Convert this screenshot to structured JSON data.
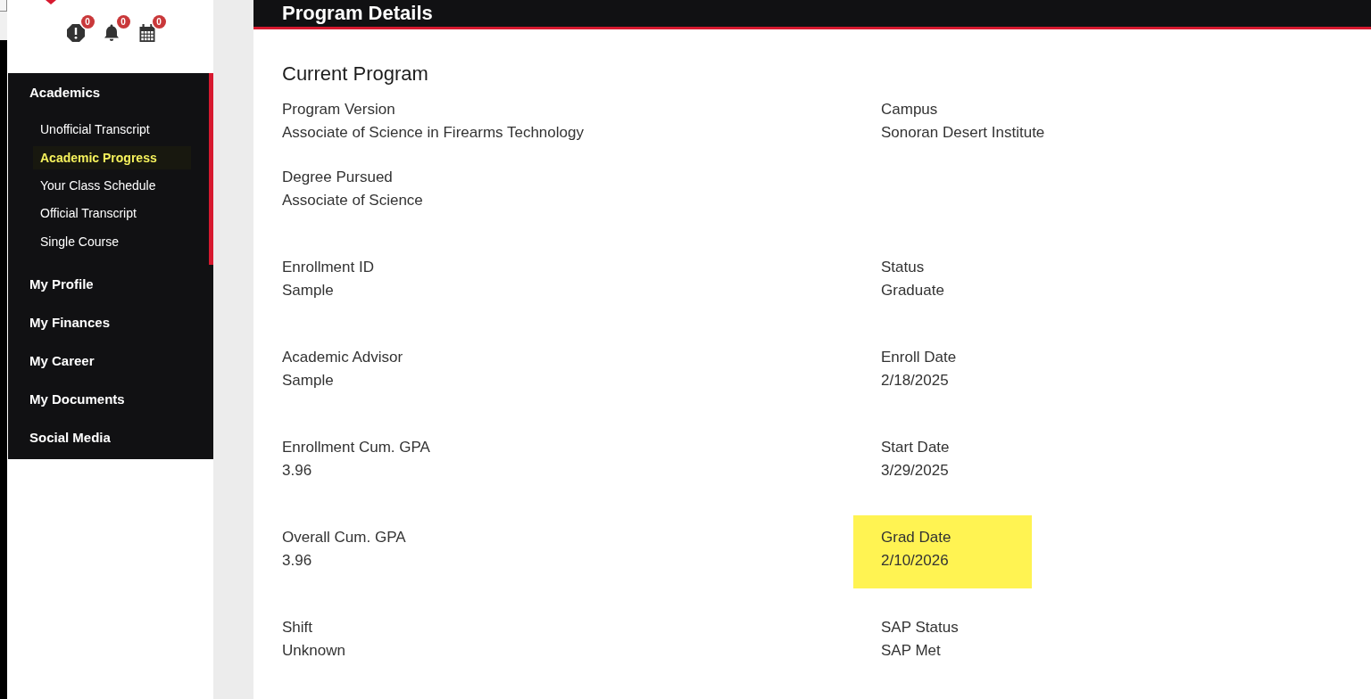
{
  "sidebar": {
    "notifications": [
      {
        "kind": "alert",
        "count": "0"
      },
      {
        "kind": "bell",
        "count": "0"
      },
      {
        "kind": "calendar",
        "count": "0"
      }
    ],
    "menu": [
      {
        "label": "Academics",
        "expanded": true,
        "children": [
          {
            "label": "Unofficial Transcript",
            "selected": false
          },
          {
            "label": "Academic Progress",
            "selected": true
          },
          {
            "label": "Your Class Schedule",
            "selected": false
          },
          {
            "label": "Official Transcript",
            "selected": false
          },
          {
            "label": "Single Course",
            "selected": false
          }
        ]
      },
      {
        "label": "My Profile",
        "expanded": false
      },
      {
        "label": "My Finances",
        "expanded": false
      },
      {
        "label": "My Career",
        "expanded": false
      },
      {
        "label": "My Documents",
        "expanded": false
      },
      {
        "label": "Social Media",
        "expanded": false
      }
    ]
  },
  "page": {
    "title": "Program Details"
  },
  "program": {
    "heading": "Current Program",
    "rows": [
      {
        "left": {
          "label": "Program Version",
          "value": "Associate of Science in Firearms Technology",
          "highlighted": false
        },
        "right": {
          "label": "Campus",
          "value": "Sonoran Desert Institute",
          "highlighted": false
        }
      },
      {
        "left": {
          "label": "Degree Pursued",
          "value": "Associate of Science",
          "highlighted": false
        }
      },
      {
        "left": {
          "label": "Enrollment ID",
          "value": "Sample",
          "highlighted": false
        },
        "right": {
          "label": "Status",
          "value": "Graduate",
          "highlighted": false
        }
      },
      {
        "left": {
          "label": "Academic Advisor",
          "value": "Sample",
          "highlighted": false
        },
        "right": {
          "label": "Enroll Date",
          "value": "2/18/2025",
          "highlighted": false
        }
      },
      {
        "left": {
          "label": "Enrollment Cum. GPA",
          "value": "3.96",
          "highlighted": false
        },
        "right": {
          "label": "Start Date",
          "value": "3/29/2025",
          "highlighted": false
        }
      },
      {
        "left": {
          "label": "Overall Cum. GPA",
          "value": "3.96",
          "highlighted": false
        },
        "right": {
          "label": "Grad Date",
          "value": "2/10/2026",
          "highlighted": true
        }
      },
      {
        "left": {
          "label": "Shift",
          "value": "Unknown",
          "highlighted": false
        },
        "right": {
          "label": "SAP Status",
          "value": "SAP Met",
          "highlighted": false
        }
      }
    ]
  }
}
